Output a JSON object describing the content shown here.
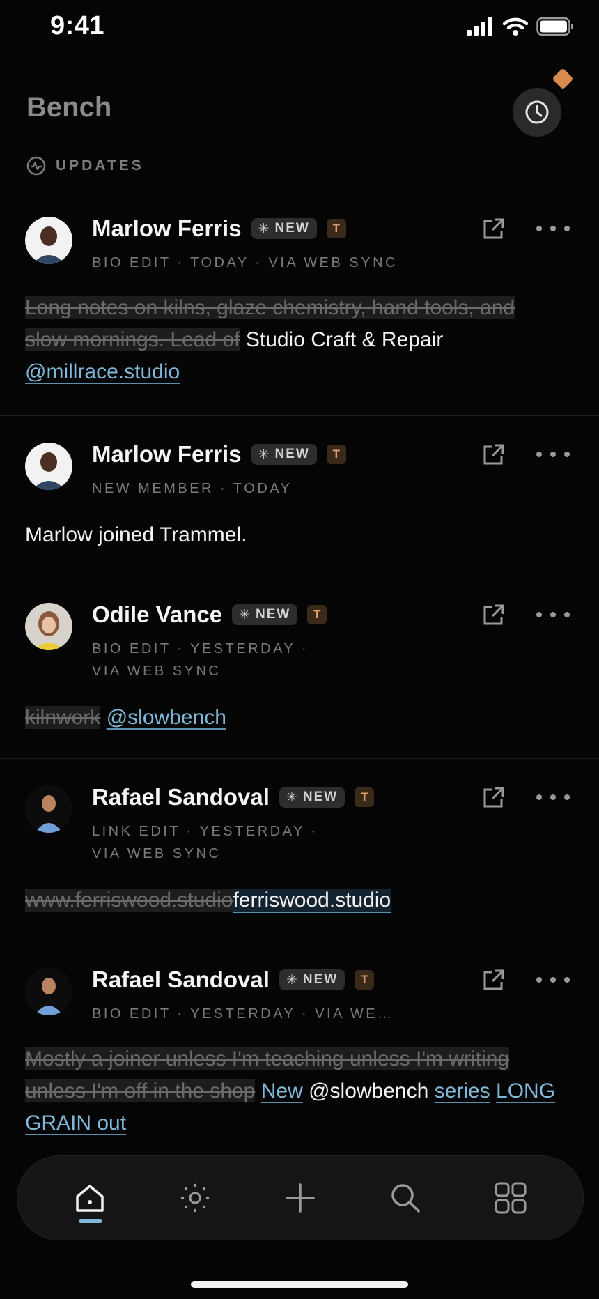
{
  "status": {
    "time": "9:41"
  },
  "header": {
    "title": "Bench",
    "section": "UPDATES"
  },
  "badges": {
    "new": "NEW",
    "t": "T"
  },
  "feed": [
    {
      "name": "Marlow Ferris",
      "meta": "BIO EDIT · TODAY · VIA WEB SYNC",
      "removed": "Long notes on kilns, glaze chemistry, hand tools, and slow mornings. Lead of",
      "added": "Studio Craft & Repair",
      "link": "@millrace.studio"
    },
    {
      "name": "Marlow Ferris",
      "meta": "NEW MEMBER · TODAY",
      "text": "Marlow joined Trammel."
    },
    {
      "name": "Odile Vance",
      "meta_line1": "BIO EDIT · YESTERDAY ·",
      "meta_line2": "VIA WEB SYNC",
      "removed": "kilnwork",
      "link": "@slowbench"
    },
    {
      "name": "Rafael Sandoval",
      "meta_line1": "LINK EDIT · YESTERDAY ·",
      "meta_line2": "VIA WEB SYNC",
      "removed": "www.ferriswood.studio",
      "added": "ferriswood.studio"
    },
    {
      "name": "Rafael Sandoval",
      "meta": "BIO EDIT · YESTERDAY · VIA WE…",
      "removed": "Mostly a joiner unless I'm teaching unless I'm writing unless I'm off in the shop",
      "added_link1": "New",
      "added_plain": "@slowbench",
      "added_link2": "series",
      "added_link3": "LONG GRAIN out"
    }
  ],
  "colors": {
    "accent": "#7fb8d9",
    "badge_orange": "#d98a4e",
    "background": "#050505"
  },
  "tabs": [
    "home-icon",
    "sun-icon",
    "plus-icon",
    "search-icon",
    "grid-icon"
  ]
}
